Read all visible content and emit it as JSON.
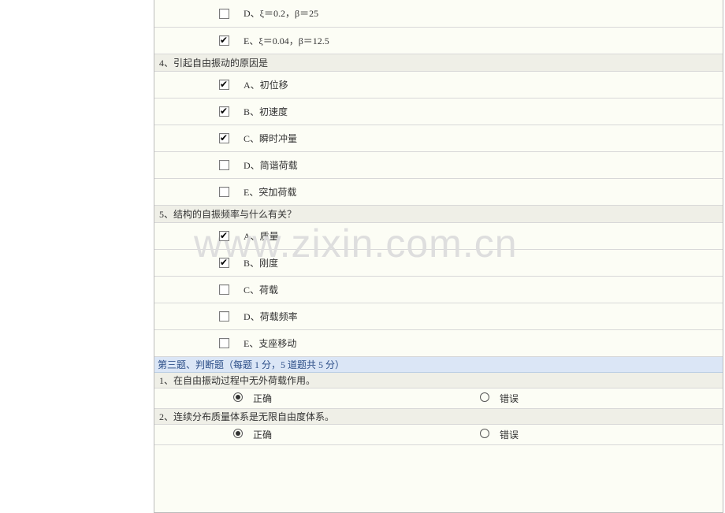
{
  "watermark": "www.zixin.com.cn",
  "prev_options": {
    "D": {
      "letter_label": "D、",
      "text": "ξ＝0.2，β＝25",
      "checked": false
    },
    "E": {
      "letter_label": "E、",
      "text": "ξ＝0.04，β＝12.5",
      "checked": true
    }
  },
  "q4": {
    "prompt": "4、引起自由振动的原因是",
    "options": {
      "A": {
        "letter_label": "A、",
        "text": "初位移",
        "checked": true
      },
      "B": {
        "letter_label": "B、",
        "text": "初速度",
        "checked": true
      },
      "C": {
        "letter_label": "C、",
        "text": "瞬时冲量",
        "checked": true
      },
      "D": {
        "letter_label": "D、",
        "text": "简谐荷载",
        "checked": false
      },
      "E": {
        "letter_label": "E、",
        "text": "突加荷载",
        "checked": false
      }
    }
  },
  "q5": {
    "prompt": "5、结构的自振频率与什么有关？",
    "options": {
      "A": {
        "letter_label": "A、",
        "text": "质量",
        "checked": true
      },
      "B": {
        "letter_label": "B、",
        "text": "刚度",
        "checked": true
      },
      "C": {
        "letter_label": "C、",
        "text": "荷载",
        "checked": false
      },
      "D": {
        "letter_label": "D、",
        "text": "荷载频率",
        "checked": false
      },
      "E": {
        "letter_label": "E、",
        "text": "支座移动",
        "checked": false
      }
    }
  },
  "section3": {
    "title": "第三题、判断题（每题 1 分，5 道题共 5 分）",
    "q1": {
      "prompt": "1、在自由振动过程中无外荷载作用。",
      "true_label": "正确",
      "false_label": "错误",
      "selected": "true"
    },
    "q2": {
      "prompt": "2、连续分布质量体系是无限自由度体系。",
      "true_label": "正确",
      "false_label": "错误",
      "selected": "true"
    }
  }
}
